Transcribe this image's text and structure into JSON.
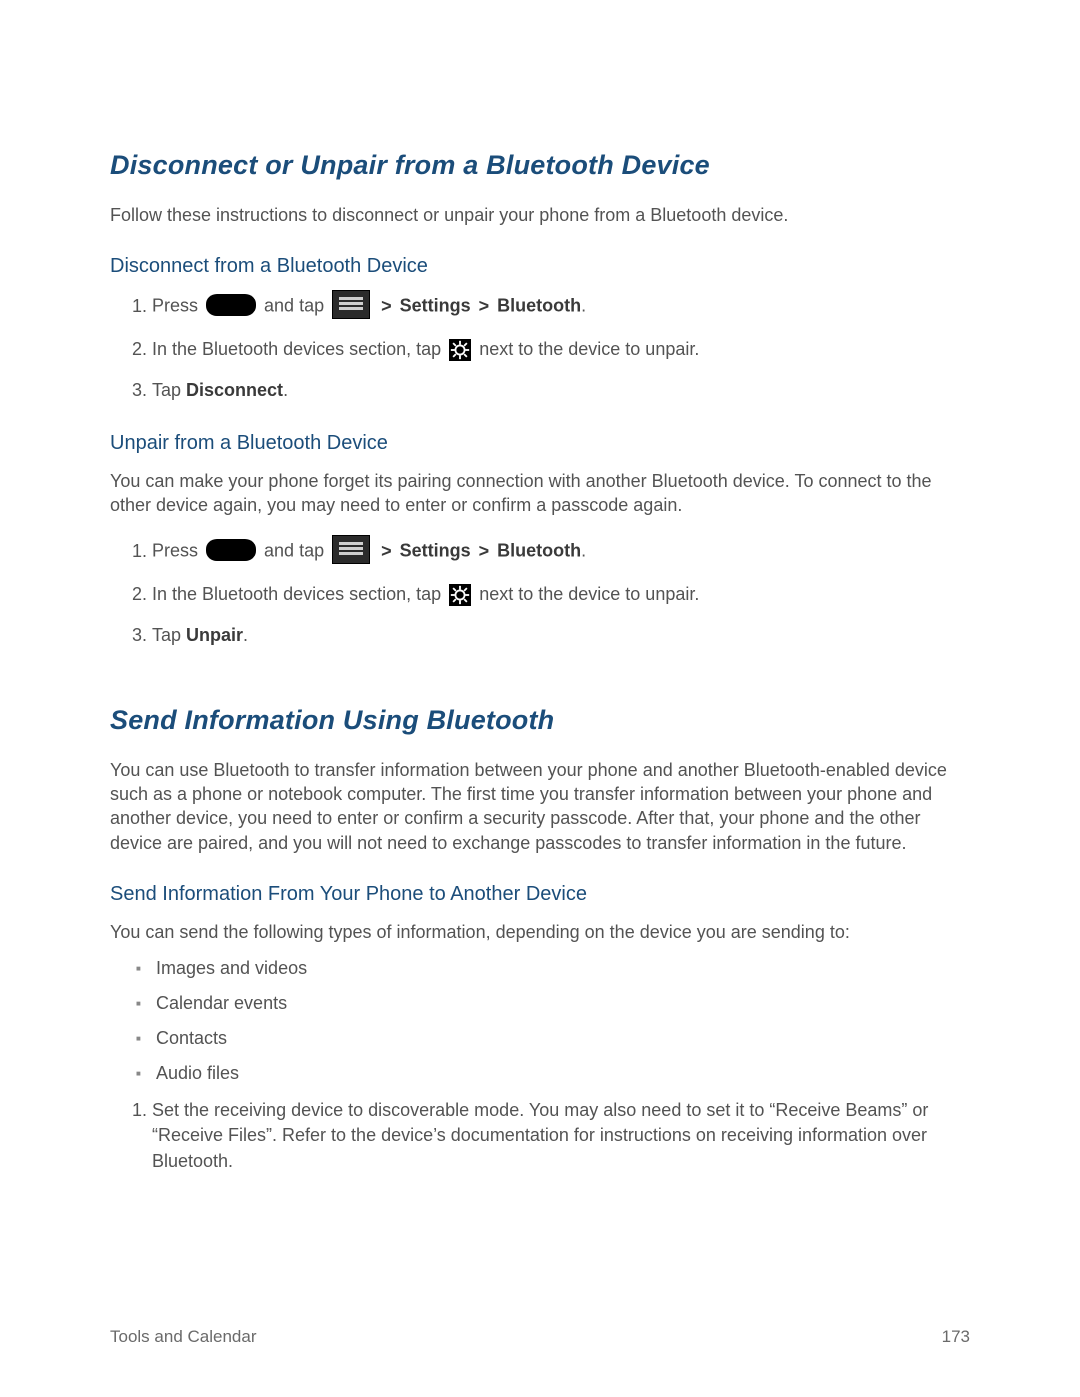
{
  "section1": {
    "title": "Disconnect or Unpair from a Bluetooth Device",
    "intro": "Follow these instructions to disconnect or unpair your phone from a Bluetooth device.",
    "sub1": {
      "title": "Disconnect from a Bluetooth Device",
      "step1_a": "Press ",
      "step1_b": " and tap ",
      "step1_c": " > ",
      "step1_settings": "Settings",
      "step1_bt": "Bluetooth",
      "step1_dot": ".",
      "step2_a": "In the Bluetooth devices section, tap ",
      "step2_b": " next to the device to unpair.",
      "step3_a": "Tap ",
      "step3_bold": "Disconnect",
      "step3_dot": "."
    },
    "sub2": {
      "title": "Unpair from a Bluetooth Device",
      "intro": "You can make your phone forget its pairing connection with another Bluetooth device. To connect to the other device again, you may need to enter or confirm a passcode again.",
      "step1_a": "Press ",
      "step1_b": " and tap ",
      "step1_c": " > ",
      "step1_settings": "Settings",
      "step1_bt": "Bluetooth",
      "step1_dot": ".",
      "step2_a": "In the Bluetooth devices section, tap ",
      "step2_b": " next to the device to unpair.",
      "step3_a": "Tap ",
      "step3_bold": "Unpair",
      "step3_dot": "."
    }
  },
  "section2": {
    "title": "Send Information Using Bluetooth",
    "intro": "You can use Bluetooth to transfer information between your phone and another Bluetooth-enabled device such as a phone or notebook computer. The first time you transfer information between your phone and another device, you need to enter or confirm a security passcode. After that, your phone and the other device are paired, and you will not need to exchange passcodes to transfer information in the future.",
    "sub1": {
      "title": "Send Information From Your Phone to Another Device",
      "intro": "You can send the following types of information, depending on the device you are sending to:",
      "bullets": [
        "Images and videos",
        "Calendar events",
        "Contacts",
        "Audio files"
      ],
      "step1": "Set the receiving device to discoverable mode. You may also need to set it to “Receive Beams” or “Receive Files”. Refer to the device’s documentation for instructions on receiving information over Bluetooth."
    }
  },
  "footer": {
    "left": "Tools and Calendar",
    "right": "173"
  }
}
